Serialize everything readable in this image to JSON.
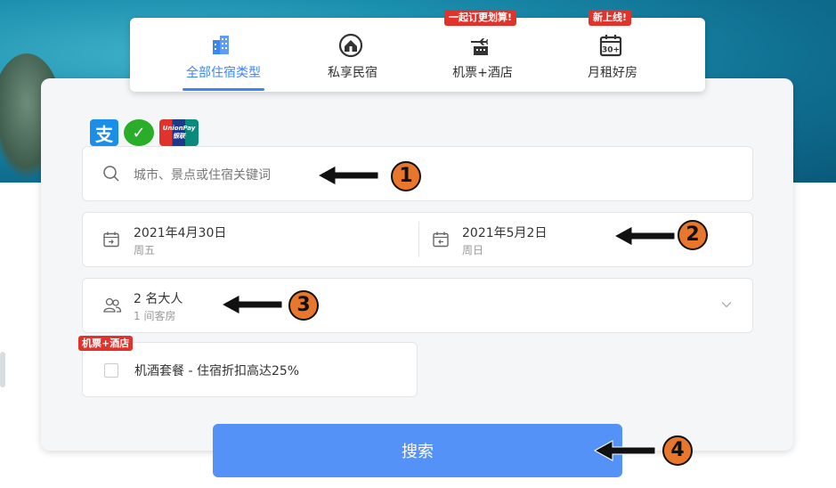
{
  "tabs": [
    {
      "label": "全部住宿类型",
      "icon": "building-icon",
      "active": true,
      "badge": ""
    },
    {
      "label": "私享民宿",
      "icon": "house-icon",
      "active": false,
      "badge": ""
    },
    {
      "label": "机票+酒店",
      "icon": "plane-hotel-icon",
      "active": false,
      "badge": "一起订更划算!"
    },
    {
      "label": "月租好房",
      "icon": "calendar-30-icon",
      "active": false,
      "badge": "新上线!"
    }
  ],
  "payments": [
    {
      "name": "alipay-icon",
      "glyph": "支",
      "color": "#1a8ee8"
    },
    {
      "name": "wechat-pay-icon",
      "glyph": "✓",
      "color": "#2aae29"
    },
    {
      "name": "unionpay-icon",
      "glyph": "UnionPay 银联",
      "color": "#e0332c"
    }
  ],
  "search": {
    "placeholder": "城市、景点或住宿关键词"
  },
  "dates": {
    "checkin": {
      "date": "2021年4月30日",
      "weekday": "周五"
    },
    "checkout": {
      "date": "2021年5月2日",
      "weekday": "周日"
    }
  },
  "guests": {
    "main": "2 名大人",
    "sub": "1 间客房"
  },
  "package": {
    "badge": "机票+酒店",
    "label": "机酒套餐 - 住宿折扣高达25%"
  },
  "search_button": {
    "label": "搜索"
  },
  "annotations": [
    "1",
    "2",
    "3",
    "4"
  ],
  "colors": {
    "accent": "#3b86f7",
    "button": "#5492f8",
    "badge": "#e0332c",
    "marker": "#e8762b"
  }
}
